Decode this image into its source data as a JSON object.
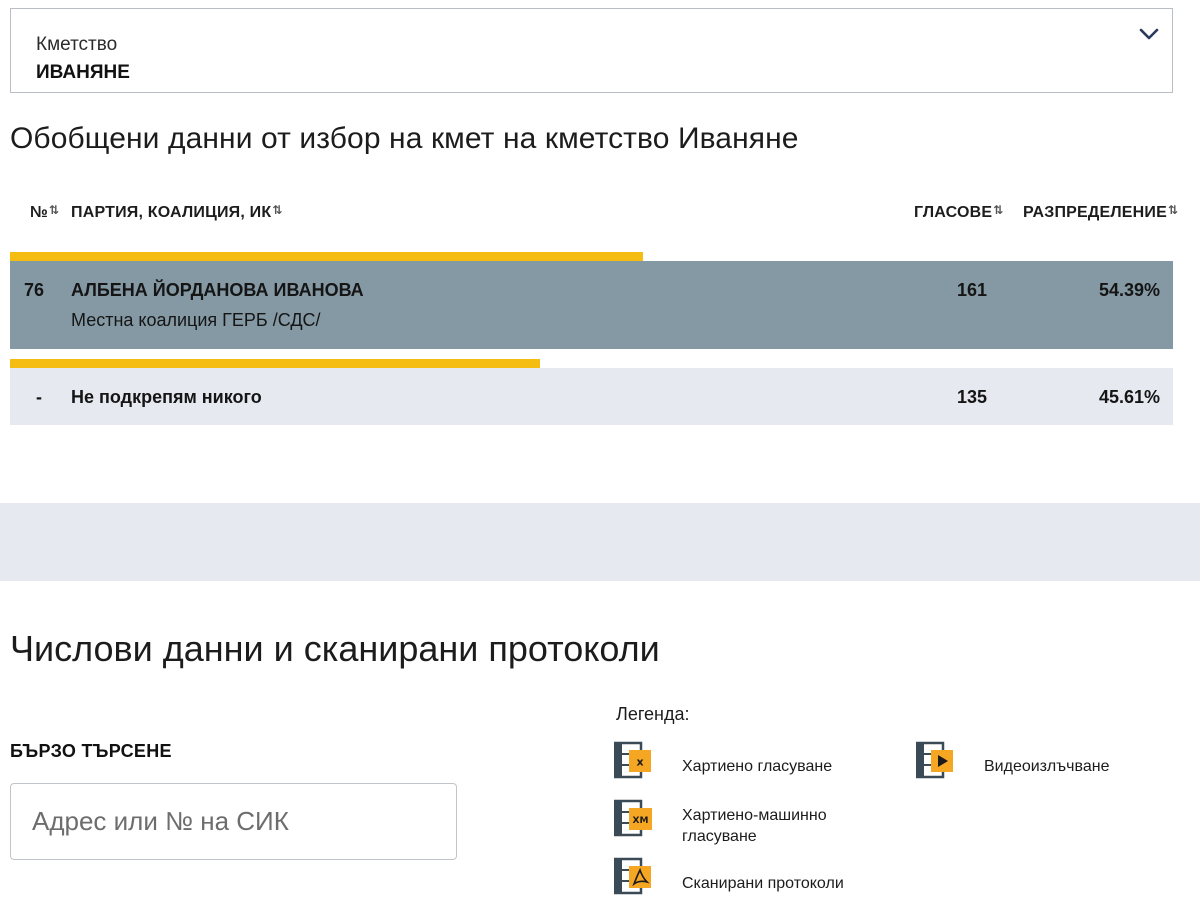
{
  "selector": {
    "label": "Кметство",
    "value": "ИВАНЯНЕ"
  },
  "summary": {
    "title": "Обобщени данни от избор на кмет на кметство Иваняне",
    "columns": {
      "number": "№",
      "party": "ПАРТИЯ, КОАЛИЦИЯ, ИК",
      "votes": "ГЛАСОВЕ",
      "distribution": "РАЗПРЕДЕЛЕНИЕ"
    },
    "sort_icon": "⇅",
    "rows": [
      {
        "number": "76",
        "name": "АЛБЕНА ЙОРДАНОВА ИВАНОВА",
        "coalition": "Местна коалиция ГЕРБ /СДС/",
        "votes": "161",
        "percent": "54.39%",
        "share": 0.5439
      },
      {
        "number": "-",
        "name": "Не подкрепям никого",
        "coalition": "",
        "votes": "135",
        "percent": "45.61%",
        "share": 0.4561
      }
    ]
  },
  "protocols": {
    "title": "Числови данни и сканирани протоколи",
    "quick_search_label": "БЪРЗО ТЪРСЕНЕ",
    "search_placeholder": "Адрес или № на СИК"
  },
  "legend": {
    "title": "Легенда:",
    "items": [
      {
        "icon": "paper-voting-icon",
        "badge": "x",
        "label": "Хартиено гласуване"
      },
      {
        "icon": "paper-machine-voting-icon",
        "badge": "XM",
        "label": "Хартиено-машинно гласуване"
      },
      {
        "icon": "scanned-protocols-icon",
        "badge": "pdf",
        "label": "Сканирани протоколи"
      },
      {
        "icon": "video-stream-icon",
        "badge": "play",
        "label": "Видеоизлъчване"
      }
    ]
  },
  "colors": {
    "accent_bar": "#f5bd12",
    "row_winner_bg": "#8499a4",
    "row_other_bg": "#e6eaf0",
    "icon_frame": "#3a4a57",
    "icon_badge": "#f5a623"
  }
}
